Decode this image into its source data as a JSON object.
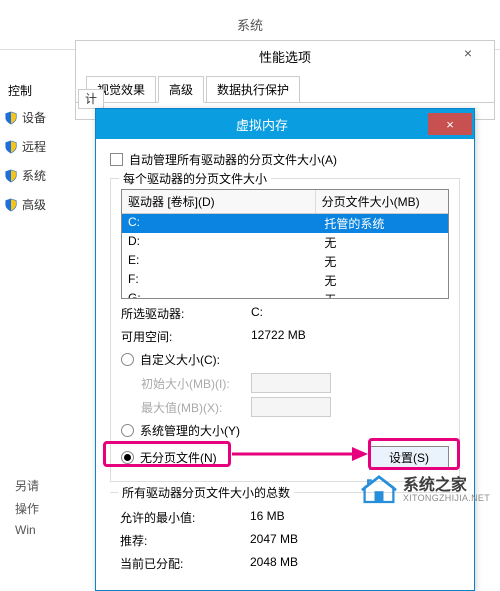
{
  "bg": {
    "system_title": "系统",
    "left_hdr": "控制",
    "left_items": [
      "设备",
      "远程",
      "系统",
      "高级"
    ],
    "sidebar2": [
      "另请",
      "操作",
      "Win"
    ],
    "inner_tab": "计"
  },
  "perf": {
    "title": "性能选项",
    "tabs": [
      "视觉效果",
      "高级",
      "数据执行保护"
    ],
    "close": "×"
  },
  "vm": {
    "title": "虚拟内存",
    "close": "×",
    "auto_checkbox": "自动管理所有驱动器的分页文件大小(A)",
    "group1_label": "每个驱动器的分页文件大小",
    "drive_hdr1": "驱动器 [卷标](D)",
    "drive_hdr2": "分页文件大小(MB)",
    "drives": [
      {
        "d": "C:",
        "s": "托管的系统",
        "sel": true
      },
      {
        "d": "D:",
        "s": "无",
        "sel": false
      },
      {
        "d": "E:",
        "s": "无",
        "sel": false
      },
      {
        "d": "F:",
        "s": "无",
        "sel": false
      },
      {
        "d": "G:",
        "s": "无",
        "sel": false
      }
    ],
    "selected_drive_label": "所选驱动器:",
    "selected_drive_value": "C:",
    "free_space_label": "可用空间:",
    "free_space_value": "12722 MB",
    "radio_custom": "自定义大小(C):",
    "initial_label": "初始大小(MB)(I):",
    "max_label": "最大值(MB)(X):",
    "radio_system": "系统管理的大小(Y)",
    "radio_none": "无分页文件(N)",
    "set_btn": "设置(S)",
    "group2_label": "所有驱动器分页文件大小的总数",
    "min_allowed_label": "允许的最小值:",
    "min_allowed_value": "16 MB",
    "recommended_label": "推荐:",
    "recommended_value": "2047 MB",
    "current_label": "当前已分配:",
    "current_value": "2048 MB"
  },
  "watermark": {
    "cn": "系统之家",
    "en": "XITONGZHIJIA.NET"
  }
}
